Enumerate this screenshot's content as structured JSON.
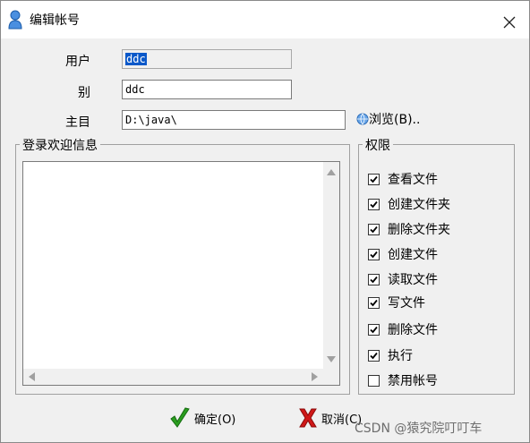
{
  "window": {
    "title": "编辑帐号",
    "icon": "user-icon",
    "close_icon": "close-icon"
  },
  "form": {
    "user_label": "用户",
    "user_value": "ddc",
    "alias_label": "别",
    "alias_value": "ddc",
    "home_label": "主目",
    "home_value": "D:\\java\\",
    "browse_label": "浏览(B)..",
    "browse_icon": "globe-icon"
  },
  "welcome": {
    "group_title": "登录欢迎信息",
    "text": ""
  },
  "permissions": {
    "group_title": "权限",
    "items": [
      {
        "label": "查看文件",
        "checked": true
      },
      {
        "label": "创建文件夹",
        "checked": true
      },
      {
        "label": "删除文件夹",
        "checked": true
      },
      {
        "label": "创建文件",
        "checked": true
      },
      {
        "label": "读取文件",
        "checked": true
      },
      {
        "label": "写文件",
        "checked": true
      },
      {
        "label": "删除文件",
        "checked": true
      },
      {
        "label": "执行",
        "checked": true
      },
      {
        "label": "禁用帐号",
        "checked": false
      }
    ]
  },
  "buttons": {
    "ok_label": "确定(O)",
    "ok_icon": "checkmark-icon",
    "cancel_label": "取消(C)",
    "cancel_icon": "red-x-icon"
  },
  "watermark": "CSDN @猿究院叮叮车",
  "colors": {
    "selection": "#0a58c9",
    "ok_green": "#2a9d1f",
    "cancel_red": "#d01818"
  }
}
